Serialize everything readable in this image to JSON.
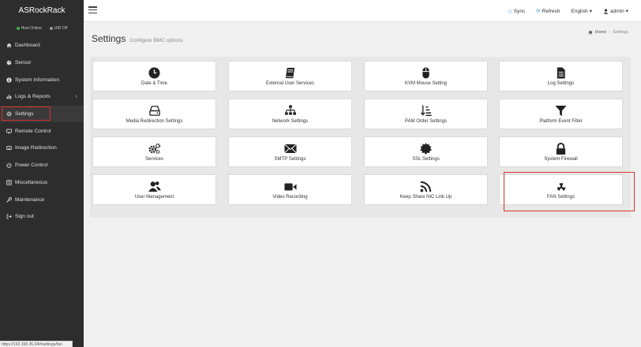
{
  "app": {
    "brand": "ASRockRack"
  },
  "status": [
    {
      "label": "Host Online",
      "color": "#3cb34a"
    },
    {
      "label": "UID Off",
      "color": "#9a9a9a"
    }
  ],
  "sidebar": {
    "items": [
      {
        "label": "Dashboard",
        "icon": "home-icon"
      },
      {
        "label": "Sensor",
        "icon": "sensor-icon"
      },
      {
        "label": "System Information",
        "icon": "info-icon"
      },
      {
        "label": "Logs & Reports",
        "icon": "bar-chart-icon",
        "has_submenu": true
      },
      {
        "label": "Settings",
        "icon": "gear-icon",
        "active": true
      },
      {
        "label": "Remote Control",
        "icon": "monitor-icon"
      },
      {
        "label": "Image Redirection",
        "icon": "disc-icon"
      },
      {
        "label": "Power Control",
        "icon": "power-icon"
      },
      {
        "label": "Miscellaneous",
        "icon": "list-icon"
      },
      {
        "label": "Maintenance",
        "icon": "wrench-icon"
      },
      {
        "label": "Sign out",
        "icon": "sign-out-icon"
      }
    ]
  },
  "topbar": {
    "sync": "Sync",
    "refresh": "Refresh",
    "language": "English",
    "user": "admin",
    "accent": "#2a8fd4"
  },
  "page": {
    "title": "Settings",
    "subtitle": "Configure BMC options",
    "breadcrumb": {
      "home": "Home",
      "current": "Settings"
    }
  },
  "tiles": [
    {
      "label": "Date & Time",
      "icon": "clock-icon"
    },
    {
      "label": "External User Services",
      "icon": "book-icon"
    },
    {
      "label": "KVM Mouse Setting",
      "icon": "mouse-icon"
    },
    {
      "label": "Log Settings",
      "icon": "file-text-icon"
    },
    {
      "label": "Media Redirection Settings",
      "icon": "hdd-icon"
    },
    {
      "label": "Network Settings",
      "icon": "sitemap-icon"
    },
    {
      "label": "PAM Order Settings",
      "icon": "sort-icon"
    },
    {
      "label": "Platform Event Filter",
      "icon": "filter-icon"
    },
    {
      "label": "Services",
      "icon": "cogs-icon"
    },
    {
      "label": "SMTP Settings",
      "icon": "envelope-icon"
    },
    {
      "label": "SSL Settings",
      "icon": "certificate-icon"
    },
    {
      "label": "System Firewall",
      "icon": "lock-icon"
    },
    {
      "label": "User Management",
      "icon": "users-icon"
    },
    {
      "label": "Video Recording",
      "icon": "video-camera-icon"
    },
    {
      "label": "Keep Share NIC Link Up",
      "icon": "rss-icon"
    },
    {
      "label": "FAN Settings",
      "icon": "fan-icon",
      "highlighted": true
    }
  ],
  "statusbar": {
    "url": "https://192.168.36.34/#settings/fan"
  },
  "colors": {
    "highlight": "#d8322d",
    "sidebar_bg": "#2d2d2d"
  }
}
